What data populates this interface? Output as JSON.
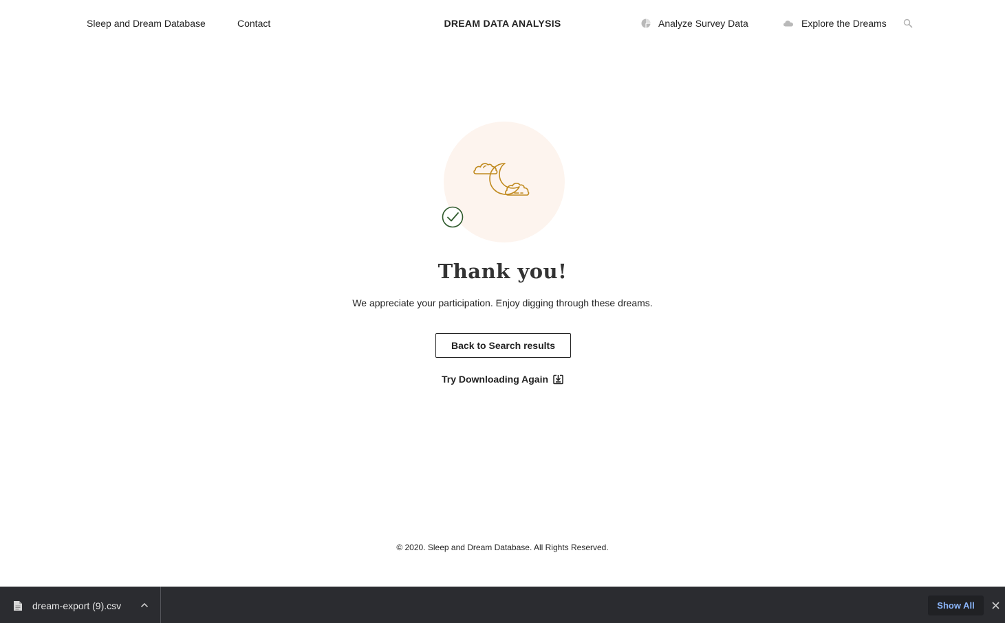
{
  "header": {
    "left_links": [
      "Sleep and Dream Database",
      "Contact"
    ],
    "brand": "DREAM DATA ANALYSIS",
    "analyze_link": "Analyze Survey Data",
    "explore_link": "Explore the Dreams",
    "icons": [
      "pie-chart-icon",
      "cloud-icon",
      "search-icon"
    ]
  },
  "main": {
    "title": "Thank you!",
    "subtitle": "We appreciate your participation. Enjoy digging through these dreams.",
    "back_button": "Back to Search results",
    "retry_link": "Try Downloading Again",
    "icons": [
      "moon-and-clouds-icon",
      "check-circle-icon",
      "download-icon"
    ]
  },
  "footer": {
    "copyright": "© 2020. Sleep and Dream Database. All Rights Reserved."
  },
  "download_bar": {
    "filename": "dream-export (9).csv",
    "show_all": "Show All"
  },
  "colors": {
    "accent_gold": "#c08a1e",
    "check_green": "#2f5a2c",
    "hero_bg": "#fdf4ee",
    "download_bar_bg": "#2b2c30",
    "show_all_text": "#8ab4f8"
  }
}
